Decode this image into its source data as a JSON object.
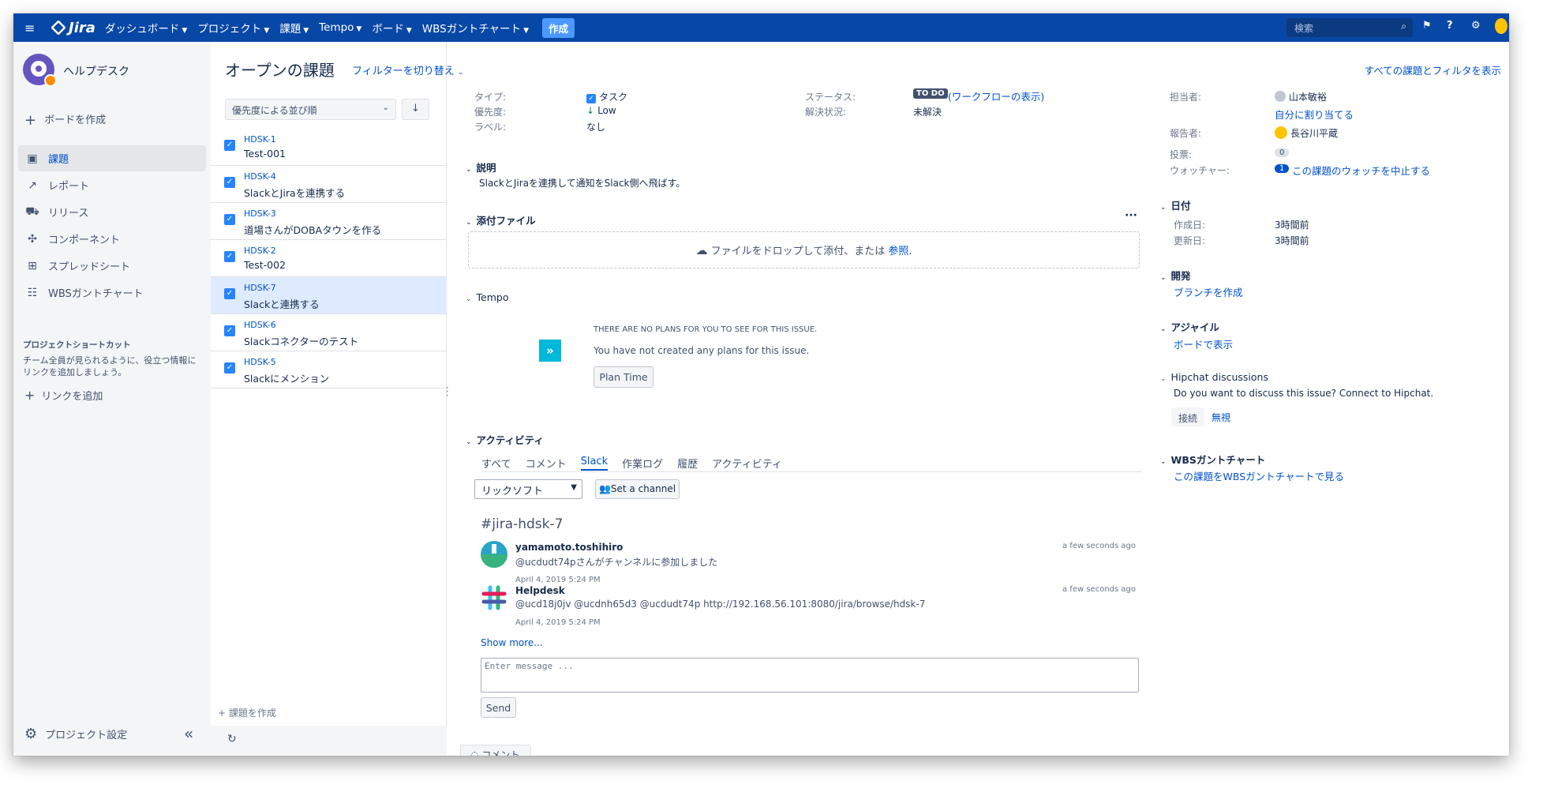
{
  "topnav": {
    "product": "Jira",
    "items": [
      "ダッシュボード",
      "プロジェクト",
      "課題",
      "Tempo",
      "ボード",
      "WBSガントチャート"
    ],
    "create_label": "作成",
    "search_placeholder": "検索"
  },
  "sidebar": {
    "project_name": "ヘルプデスク",
    "add_board": "ボードを作成",
    "items": [
      {
        "label": "課題",
        "icon": "issues-icon"
      },
      {
        "label": "レポート",
        "icon": "reports-icon"
      },
      {
        "label": "リリース",
        "icon": "releases-icon"
      },
      {
        "label": "コンポーネント",
        "icon": "components-icon"
      },
      {
        "label": "スプレッドシート",
        "icon": "spreadsheet-icon"
      },
      {
        "label": "WBSガントチャート",
        "icon": "gantt-icon"
      }
    ],
    "shortcut_title": "プロジェクトショートカット",
    "shortcut_desc": "チーム全員が見られるように、役立つ情報にリンクを追加しましょう。",
    "add_link": "リンクを追加",
    "settings": "プロジェクト設定"
  },
  "header": {
    "title": "オープンの課題",
    "filter_switch": "フィルターを切り替え",
    "all_filters": "すべての課題とフィルタを表示"
  },
  "list": {
    "sort_label": "優先度による並び順",
    "sort_dir": "↓",
    "create_issue": "+ 課題を作成",
    "issues": [
      {
        "key": "HDSK-1",
        "summary": "Test-001"
      },
      {
        "key": "HDSK-4",
        "summary": "SlackとJiraを連携する"
      },
      {
        "key": "HDSK-3",
        "summary": "道場さんがDOBAタウンを作る"
      },
      {
        "key": "HDSK-2",
        "summary": "Test-002"
      },
      {
        "key": "HDSK-7",
        "summary": "Slackと連携する"
      },
      {
        "key": "HDSK-6",
        "summary": "Slackコネクターのテスト"
      },
      {
        "key": "HDSK-5",
        "summary": "Slackにメンション"
      }
    ]
  },
  "details": {
    "type_label": "タイプ:",
    "type_value": "タスク",
    "priority_label": "優先度:",
    "priority_value": "Low",
    "labels_label": "ラベル:",
    "labels_value": "なし",
    "status_label": "ステータス:",
    "status_value": "TO DO",
    "workflow_link": "(ワークフローの表示)",
    "resolution_label": "解決状況:",
    "resolution_value": "未解決"
  },
  "description": {
    "heading": "説明",
    "text": "SlackとJiraを連携して通知をSlack側へ飛ばす。"
  },
  "attachments": {
    "heading": "添付ファイル",
    "more": "···",
    "drop_text": "ファイルをドロップして添付、または",
    "browse": "参照."
  },
  "tempo": {
    "heading": "Tempo",
    "no_plans_title": "THERE ARE NO PLANS FOR YOU TO SEE FOR THIS ISSUE.",
    "no_plans_text": "You have not created any plans for this issue.",
    "plan_button": "Plan Time"
  },
  "activity": {
    "heading": "アクティビティ",
    "tabs": [
      "すべて",
      "コメント",
      "Slack",
      "作業ログ",
      "履歴",
      "アクティビティ"
    ],
    "active_tab": "Slack",
    "workspace": "リックソフト",
    "set_channel": "Set a channel",
    "channel": "#jira-hdsk-7",
    "messages": [
      {
        "user": "yamamoto.toshihiro",
        "text": "@ucdudt74pさんがチャンネルに参加しました",
        "date": "April 4, 2019 5:24 PM",
        "ago": "a few seconds ago"
      },
      {
        "user": "Helpdesk",
        "text": "@ucd18j0jv @ucdnh65d3 @ucdudt74p http://192.168.56.101:8080/jira/browse/hdsk-7",
        "date": "April 4, 2019 5:24 PM",
        "ago": "a few seconds ago"
      }
    ],
    "show_more": "Show more...",
    "message_placeholder": "Enter message ...",
    "send": "Send",
    "comment_button": "コメント"
  },
  "people": {
    "assignee_label": "担当者:",
    "assignee_value": "山本敏裕",
    "assign_me": "自分に割り当てる",
    "reporter_label": "報告者:",
    "reporter_value": "長谷川平蔵",
    "votes_label": "投票:",
    "votes_value": "0",
    "watchers_label": "ウォッチャー:",
    "watchers_value": "1",
    "stop_watch": "この課題のウォッチを中止する"
  },
  "dates": {
    "heading": "日付",
    "created_label": "作成日:",
    "created_value": "3時間前",
    "updated_label": "更新日:",
    "updated_value": "3時間前"
  },
  "development": {
    "heading": "開発",
    "create_branch": "ブランチを作成"
  },
  "agile": {
    "heading": "アジャイル",
    "view_board": "ボードで表示"
  },
  "hipchat": {
    "heading": "Hipchat discussions",
    "text": "Do you want to discuss this issue? Connect to Hipchat.",
    "connect": "接続",
    "ignore": "無視"
  },
  "wbs": {
    "heading": "WBSガントチャート",
    "link": "この課題をWBSガントチャートで見る"
  },
  "colors": {
    "nav": "#0747a6",
    "link": "#0052cc",
    "active_row": "#deebff",
    "checkbox": "#2684ff"
  }
}
